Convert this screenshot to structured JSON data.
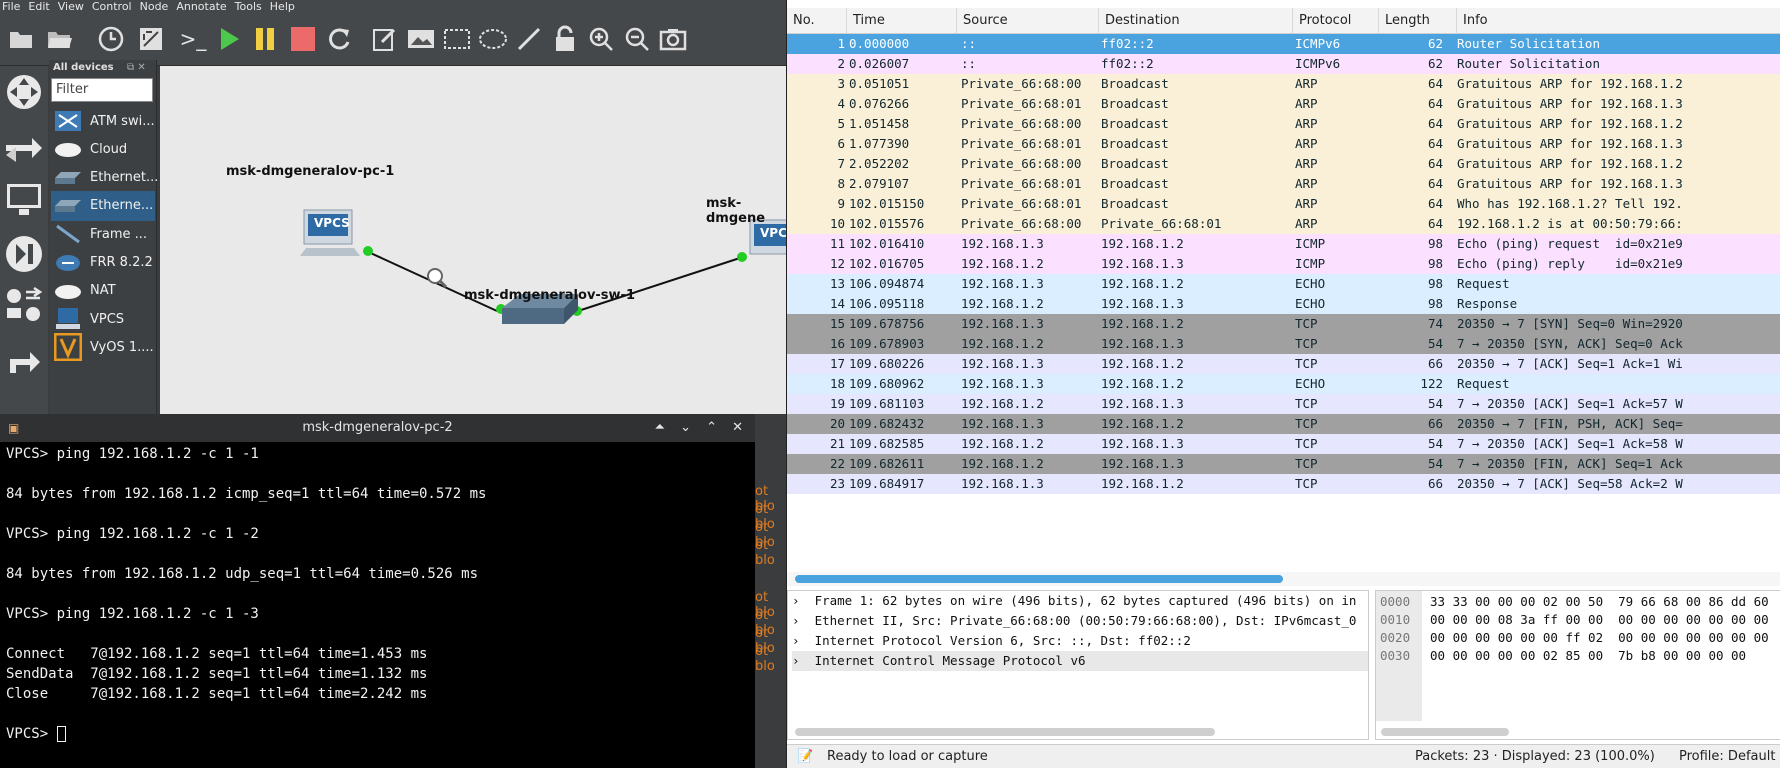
{
  "menu": [
    "File",
    "Edit",
    "View",
    "Control",
    "Node",
    "Annotate",
    "Tools",
    "Help"
  ],
  "devices": {
    "title": "All devices",
    "filter_placeholder": "Filter",
    "items": [
      {
        "label": "ATM swi...",
        "icon": "atm-switch-icon"
      },
      {
        "label": "Cloud",
        "icon": "cloud-icon"
      },
      {
        "label": "Ethernet...",
        "icon": "ethernet-hub-icon"
      },
      {
        "label": "Etherne...",
        "icon": "ethernet-switch-icon"
      },
      {
        "label": "Frame ...",
        "icon": "frame-relay-icon"
      },
      {
        "label": "FRR 8.2.2",
        "icon": "router-icon"
      },
      {
        "label": "NAT",
        "icon": "nat-icon"
      },
      {
        "label": "VPCS",
        "icon": "vpcs-icon"
      },
      {
        "label": "VyOS 1....",
        "icon": "vyos-icon"
      }
    ]
  },
  "topology": {
    "pc1_label": "msk-dmgeneralov-pc-1",
    "sw1_label": "msk-dmgeneralov-sw-1",
    "pc2_label": "msk-dmgene",
    "vpcs_badge": "VPCS",
    "vpcs_badge_short": "VPC"
  },
  "terminal": {
    "title": "msk-dmgeneralov-pc-2",
    "lines": [
      "VPCS> ping 192.168.1.2 -c 1 -1",
      "",
      "84 bytes from 192.168.1.2 icmp_seq=1 ttl=64 time=0.572 ms",
      "",
      "VPCS> ping 192.168.1.2 -c 1 -2",
      "",
      "84 bytes from 192.168.1.2 udp_seq=1 ttl=64 time=0.526 ms",
      "",
      "VPCS> ping 192.168.1.2 -c 1 -3",
      "",
      "Connect   7@192.168.1.2 seq=1 ttl=64 time=1.453 ms",
      "SendData  7@192.168.1.2 seq=1 ttl=64 time=1.132 ms",
      "Close     7@192.168.1.2 seq=1 ttl=64 time=2.242 ms",
      "",
      "VPCS> "
    ],
    "behind_text": [
      "ot blo",
      "ot blo",
      "ot blo",
      "ot blo",
      "ot blo",
      "ot blo",
      "ot blo",
      "ot blo"
    ]
  },
  "packets": {
    "columns": [
      "No.",
      "Time",
      "Source",
      "Destination",
      "Protocol",
      "Length",
      "Info"
    ],
    "rows": [
      {
        "no": "1",
        "time": "0.000000",
        "src": "::",
        "dst": "ff02::2",
        "proto": "ICMPv6",
        "len": "62",
        "info": "Router Solicitation",
        "bg": "#4aa3df",
        "fg": "#ffffff"
      },
      {
        "no": "2",
        "time": "0.026007",
        "src": "::",
        "dst": "ff02::2",
        "proto": "ICMPv6",
        "len": "62",
        "info": "Router Solicitation",
        "bg": "#fce0ff",
        "fg": "#12272e"
      },
      {
        "no": "3",
        "time": "0.051051",
        "src": "Private_66:68:00",
        "dst": "Broadcast",
        "proto": "ARP",
        "len": "64",
        "info": "Gratuitous ARP for 192.168.1.2",
        "bg": "#faf0d7",
        "fg": "#12272e"
      },
      {
        "no": "4",
        "time": "0.076266",
        "src": "Private_66:68:01",
        "dst": "Broadcast",
        "proto": "ARP",
        "len": "64",
        "info": "Gratuitous ARP for 192.168.1.3",
        "bg": "#faf0d7",
        "fg": "#12272e"
      },
      {
        "no": "5",
        "time": "1.051458",
        "src": "Private_66:68:00",
        "dst": "Broadcast",
        "proto": "ARP",
        "len": "64",
        "info": "Gratuitous ARP for 192.168.1.2",
        "bg": "#faf0d7",
        "fg": "#12272e"
      },
      {
        "no": "6",
        "time": "1.077390",
        "src": "Private_66:68:01",
        "dst": "Broadcast",
        "proto": "ARP",
        "len": "64",
        "info": "Gratuitous ARP for 192.168.1.3",
        "bg": "#faf0d7",
        "fg": "#12272e"
      },
      {
        "no": "7",
        "time": "2.052202",
        "src": "Private_66:68:00",
        "dst": "Broadcast",
        "proto": "ARP",
        "len": "64",
        "info": "Gratuitous ARP for 192.168.1.2",
        "bg": "#faf0d7",
        "fg": "#12272e"
      },
      {
        "no": "8",
        "time": "2.079107",
        "src": "Private_66:68:01",
        "dst": "Broadcast",
        "proto": "ARP",
        "len": "64",
        "info": "Gratuitous ARP for 192.168.1.3",
        "bg": "#faf0d7",
        "fg": "#12272e"
      },
      {
        "no": "9",
        "time": "102.015150",
        "src": "Private_66:68:01",
        "dst": "Broadcast",
        "proto": "ARP",
        "len": "64",
        "info": "Who has 192.168.1.2? Tell 192.",
        "bg": "#faf0d7",
        "fg": "#12272e"
      },
      {
        "no": "10",
        "time": "102.015576",
        "src": "Private_66:68:00",
        "dst": "Private_66:68:01",
        "proto": "ARP",
        "len": "64",
        "info": "192.168.1.2 is at 00:50:79:66:",
        "bg": "#faf0d7",
        "fg": "#12272e"
      },
      {
        "no": "11",
        "time": "102.016410",
        "src": "192.168.1.3",
        "dst": "192.168.1.2",
        "proto": "ICMP",
        "len": "98",
        "info": "Echo (ping) request  id=0x21e9",
        "bg": "#fce0ff",
        "fg": "#12272e"
      },
      {
        "no": "12",
        "time": "102.016705",
        "src": "192.168.1.2",
        "dst": "192.168.1.3",
        "proto": "ICMP",
        "len": "98",
        "info": "Echo (ping) reply    id=0x21e9",
        "bg": "#fce0ff",
        "fg": "#12272e"
      },
      {
        "no": "13",
        "time": "106.094874",
        "src": "192.168.1.3",
        "dst": "192.168.1.2",
        "proto": "ECHO",
        "len": "98",
        "info": "Request",
        "bg": "#daeeff",
        "fg": "#12272e"
      },
      {
        "no": "14",
        "time": "106.095118",
        "src": "192.168.1.2",
        "dst": "192.168.1.3",
        "proto": "ECHO",
        "len": "98",
        "info": "Response",
        "bg": "#daeeff",
        "fg": "#12272e"
      },
      {
        "no": "15",
        "time": "109.678756",
        "src": "192.168.1.3",
        "dst": "192.168.1.2",
        "proto": "TCP",
        "len": "74",
        "info": "20350 → 7 [SYN] Seq=0 Win=2920",
        "bg": "#a0a0a0",
        "fg": "#12272e"
      },
      {
        "no": "16",
        "time": "109.678903",
        "src": "192.168.1.2",
        "dst": "192.168.1.3",
        "proto": "TCP",
        "len": "54",
        "info": "7 → 20350 [SYN, ACK] Seq=0 Ack",
        "bg": "#a0a0a0",
        "fg": "#12272e"
      },
      {
        "no": "17",
        "time": "109.680226",
        "src": "192.168.1.3",
        "dst": "192.168.1.2",
        "proto": "TCP",
        "len": "66",
        "info": "20350 → 7 [ACK] Seq=1 Ack=1 Wi",
        "bg": "#e7e6ff",
        "fg": "#12272e"
      },
      {
        "no": "18",
        "time": "109.680962",
        "src": "192.168.1.3",
        "dst": "192.168.1.2",
        "proto": "ECHO",
        "len": "122",
        "info": "Request",
        "bg": "#daeeff",
        "fg": "#12272e"
      },
      {
        "no": "19",
        "time": "109.681103",
        "src": "192.168.1.2",
        "dst": "192.168.1.3",
        "proto": "TCP",
        "len": "54",
        "info": "7 → 20350 [ACK] Seq=1 Ack=57 W",
        "bg": "#e7e6ff",
        "fg": "#12272e"
      },
      {
        "no": "20",
        "time": "109.682432",
        "src": "192.168.1.3",
        "dst": "192.168.1.2",
        "proto": "TCP",
        "len": "66",
        "info": "20350 → 7 [FIN, PSH, ACK] Seq=",
        "bg": "#a0a0a0",
        "fg": "#12272e"
      },
      {
        "no": "21",
        "time": "109.682585",
        "src": "192.168.1.2",
        "dst": "192.168.1.3",
        "proto": "TCP",
        "len": "54",
        "info": "7 → 20350 [ACK] Seq=1 Ack=58 W",
        "bg": "#e7e6ff",
        "fg": "#12272e"
      },
      {
        "no": "22",
        "time": "109.682611",
        "src": "192.168.1.2",
        "dst": "192.168.1.3",
        "proto": "TCP",
        "len": "54",
        "info": "7 → 20350 [FIN, ACK] Seq=1 Ack",
        "bg": "#a0a0a0",
        "fg": "#12272e"
      },
      {
        "no": "23",
        "time": "109.684917",
        "src": "192.168.1.3",
        "dst": "192.168.1.2",
        "proto": "TCP",
        "len": "66",
        "info": "20350 → 7 [ACK] Seq=58 Ack=2 W",
        "bg": "#e7e6ff",
        "fg": "#12272e"
      }
    ]
  },
  "details": [
    "Frame 1: 62 bytes on wire (496 bits), 62 bytes captured (496 bits) on in",
    "Ethernet II, Src: Private_66:68:00 (00:50:79:66:68:00), Dst: IPv6mcast_0",
    "Internet Protocol Version 6, Src: ::, Dst: ff02::2",
    "Internet Control Message Protocol v6"
  ],
  "hexdump": {
    "offsets": [
      "0000",
      "0010",
      "0020",
      "0030"
    ],
    "bytes": [
      "33 33 00 00 00 02 00 50  79 66 68 00 86 dd 60",
      "00 00 00 08 3a ff 00 00  00 00 00 00 00 00 00",
      "00 00 00 00 00 00 ff 02  00 00 00 00 00 00 00",
      "00 00 00 00 00 02 85 00  7b b8 00 00 00 00"
    ]
  },
  "status": {
    "ready": "Ready to load or capture",
    "packets": "Packets: 23 · Displayed: 23 (100.0%)",
    "profile": "Profile: Default"
  },
  "colors": {
    "accent": "#2f5f88",
    "link_dot": "#22cc22"
  }
}
